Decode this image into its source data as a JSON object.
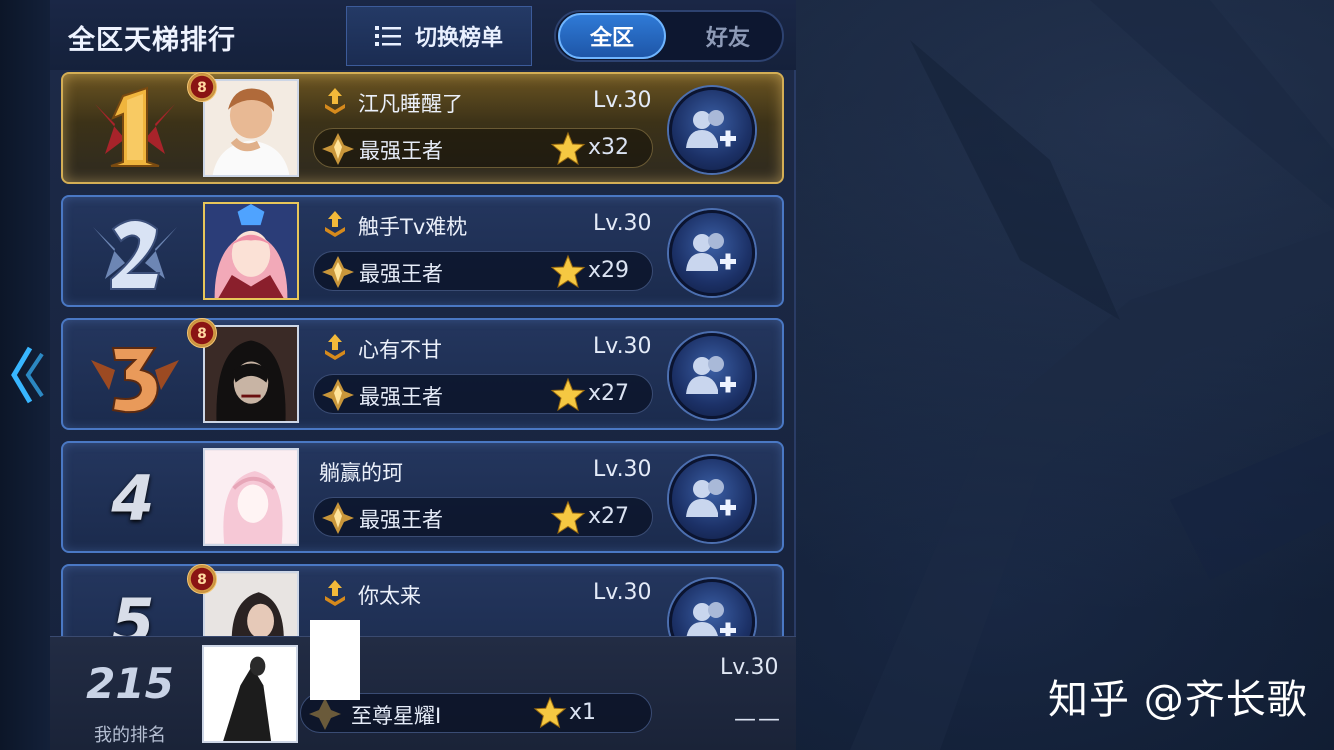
{
  "header": {
    "title": "全区天梯排行",
    "switch_label": "切换榜单",
    "segments": {
      "all": "全区",
      "friends": "好友"
    }
  },
  "rows": [
    {
      "rank": "1",
      "name": "江凡睡醒了",
      "level": "Lv.30",
      "tier": "最强王者",
      "stars": "x32",
      "badge": "8"
    },
    {
      "rank": "2",
      "name": "触手Tv难枕",
      "level": "Lv.30",
      "tier": "最强王者",
      "stars": "x29"
    },
    {
      "rank": "3",
      "name": "心有不甘",
      "level": "Lv.30",
      "tier": "最强王者",
      "stars": "x27",
      "badge": "8"
    },
    {
      "rank": "4",
      "name": "躺赢的珂",
      "level": "Lv.30",
      "tier": "最强王者",
      "stars": "x27"
    },
    {
      "rank": "5",
      "name": "你太来",
      "level": "Lv.30",
      "badge": "8"
    }
  ],
  "me": {
    "rank": "215",
    "rank_label": "我的排名",
    "level": "Lv.30",
    "tier": "至尊星耀I",
    "stars": "x1",
    "dash": "——"
  },
  "watermark": "知乎 @齐长歌",
  "icons": {
    "back": "double-chevron-left-icon",
    "list": "list-icon",
    "add_friend": "add-friend-icon",
    "star": "star-icon",
    "tier": "tier-emblem-icon",
    "noble": "noble-icon"
  },
  "colors": {
    "accent": "#2f7ad6",
    "row_border": "#4a78c4",
    "gold_border": "#d4ae55"
  }
}
